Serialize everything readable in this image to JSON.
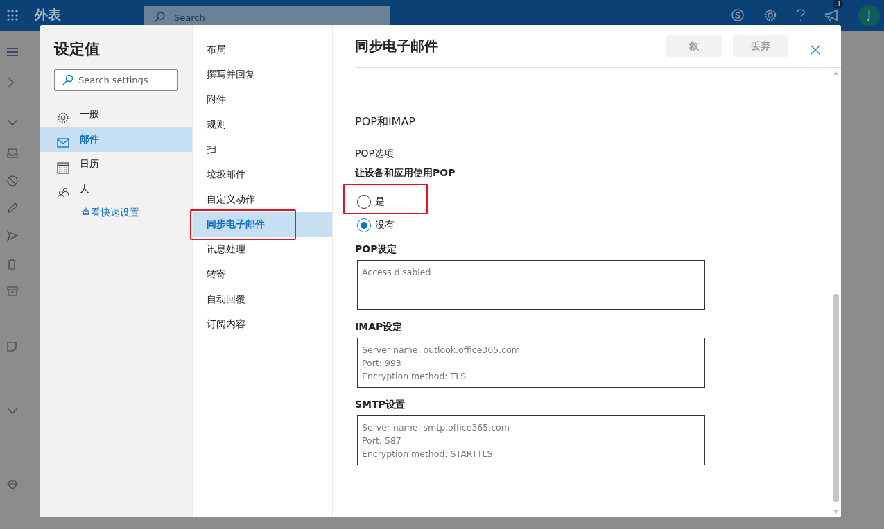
{
  "topbar": {
    "app_name": "外表",
    "search": {
      "placeholder": "Search"
    },
    "notification_count": "3",
    "avatar_initial": "J"
  },
  "settings": {
    "title": "设定值",
    "search": {
      "placeholder": "Search settings"
    },
    "categories": [
      {
        "label": "一般",
        "kind": "gear",
        "selected": false
      },
      {
        "label": "邮件",
        "kind": "mail",
        "selected": true
      },
      {
        "label": "日历",
        "kind": "calendar",
        "selected": false
      },
      {
        "label": "人",
        "kind": "people",
        "selected": false
      }
    ],
    "quick_link": "查看快速设置"
  },
  "subnav": [
    {
      "label": "布局",
      "selected": false,
      "highlighted": false
    },
    {
      "label": "撰写并回复",
      "selected": false,
      "highlighted": false
    },
    {
      "label": "附件",
      "selected": false,
      "highlighted": false
    },
    {
      "label": "规则",
      "selected": false,
      "highlighted": false
    },
    {
      "label": "扫",
      "selected": false,
      "highlighted": false
    },
    {
      "label": "垃圾邮件",
      "selected": false,
      "highlighted": false
    },
    {
      "label": "自定义动作",
      "selected": false,
      "highlighted": false
    },
    {
      "label": "同步电子邮件",
      "selected": true,
      "highlighted": true
    },
    {
      "label": "讯息处理",
      "selected": false,
      "highlighted": false
    },
    {
      "label": "转寄",
      "selected": false,
      "highlighted": false
    },
    {
      "label": "自动回覆",
      "selected": false,
      "highlighted": false
    },
    {
      "label": "订阅内容",
      "selected": false,
      "highlighted": false
    }
  ],
  "content": {
    "title": "同步电子邮件",
    "buttons": [
      {
        "label": "救",
        "disabled": true
      },
      {
        "label": "丢弃",
        "disabled": true
      }
    ],
    "section_title": "POP和IMAP",
    "pop_options_label": "POP选项",
    "question": "让设备和应用使用POP",
    "radios": [
      {
        "label": "是",
        "selected": false,
        "highlighted": true
      },
      {
        "label": "没有",
        "selected": true,
        "highlighted": false
      }
    ],
    "boxes": [
      {
        "label": "POP设定",
        "lines": [
          "Access disabled"
        ]
      },
      {
        "label": "IMAP设定",
        "lines": [
          "Server name: outlook.office365.com",
          "Port: 993",
          "Encryption method: TLS"
        ]
      },
      {
        "label": "SMTP设置",
        "lines": [
          "Server name: smtp.office365.com",
          "Port: 587",
          "Encryption method: STARTTLS"
        ]
      }
    ]
  }
}
